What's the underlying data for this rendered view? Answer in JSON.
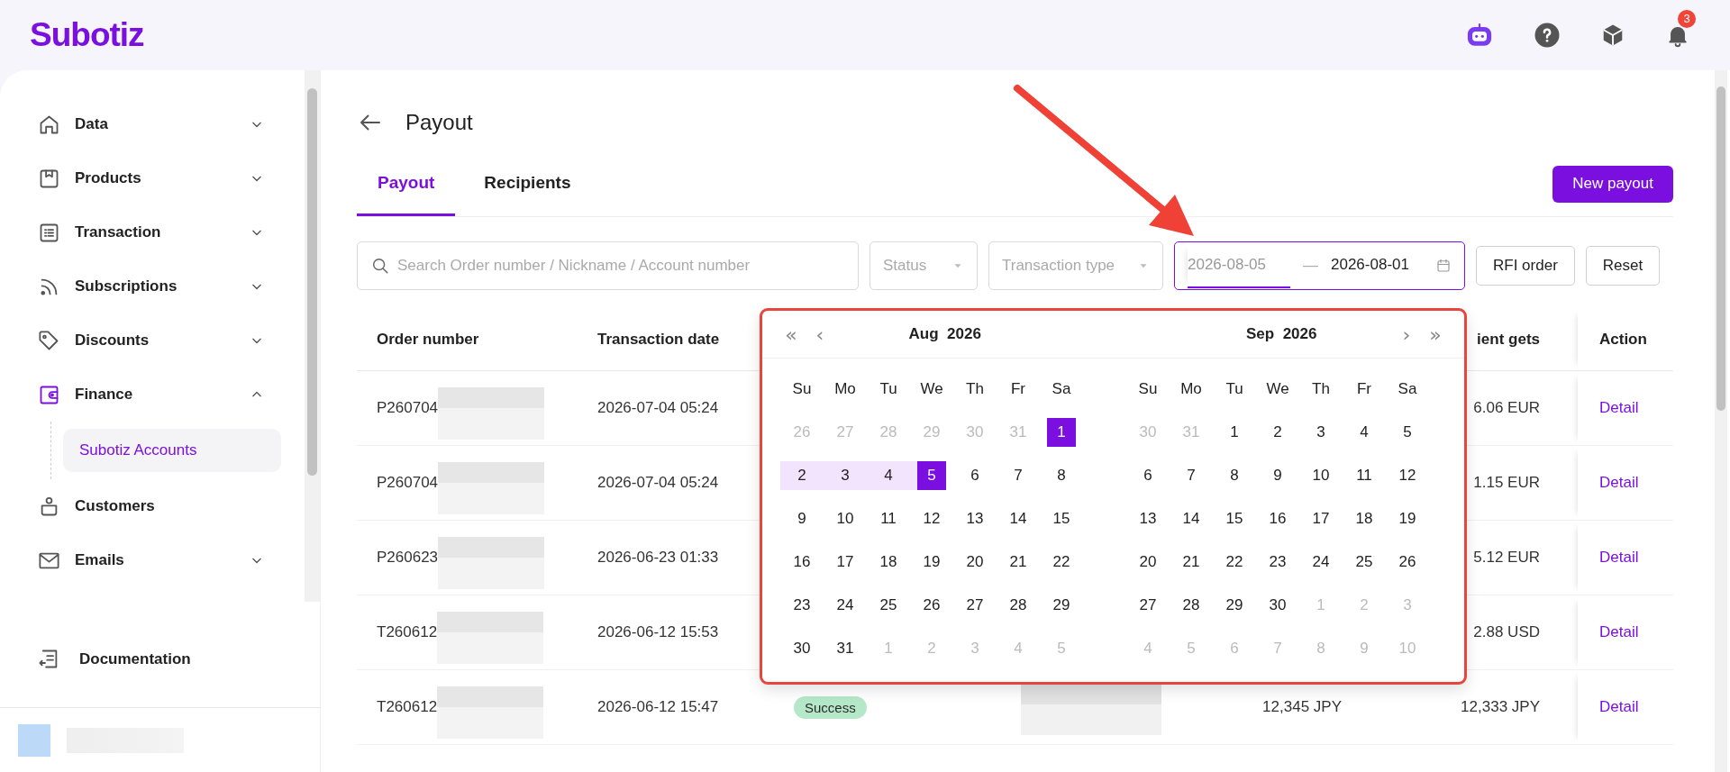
{
  "header": {
    "logo": "Subotiz",
    "notification_count": "3"
  },
  "sidebar": {
    "items": [
      {
        "label": "Data",
        "kind": "group",
        "expanded": false
      },
      {
        "label": "Products",
        "kind": "group",
        "expanded": false
      },
      {
        "label": "Transaction",
        "kind": "group",
        "expanded": false
      },
      {
        "label": "Subscriptions",
        "kind": "group",
        "expanded": false
      },
      {
        "label": "Discounts",
        "kind": "group",
        "expanded": false
      },
      {
        "label": "Finance",
        "kind": "group",
        "expanded": true,
        "children": [
          {
            "label": "Subotiz Accounts",
            "selected": true
          }
        ]
      },
      {
        "label": "Customers",
        "kind": "link"
      },
      {
        "label": "Emails",
        "kind": "group",
        "expanded": false
      }
    ],
    "footer": {
      "label": "Documentation"
    }
  },
  "page": {
    "title": "Payout",
    "tabs": [
      {
        "label": "Payout",
        "selected": true
      },
      {
        "label": "Recipients",
        "selected": false
      }
    ],
    "primary_button": "New payout"
  },
  "filters": {
    "search": {
      "placeholder": "Search Order number / Nickname / Account number"
    },
    "status": {
      "placeholder": "Status"
    },
    "transaction_type": {
      "placeholder": "Transaction type"
    },
    "date_range": {
      "start": {
        "value": "2026-08-05",
        "active": true
      },
      "separator": "—",
      "end": {
        "value": "2026-08-01",
        "active": false
      }
    },
    "buttons": [
      "RFI order",
      "Reset"
    ]
  },
  "table": {
    "columns": [
      "Order number",
      "Transaction date",
      null,
      null,
      null,
      "ient gets",
      "Action"
    ],
    "rows": [
      {
        "order_number": "P260704",
        "transaction_date": "2026-07-04 05:24",
        "recipient_gets": "6.06 EUR",
        "action": "Detail"
      },
      {
        "order_number": "P260704",
        "transaction_date": "2026-07-04 05:24",
        "recipient_gets": "1.15 EUR",
        "action": "Detail"
      },
      {
        "order_number": "P260623",
        "transaction_date": "2026-06-23 01:33",
        "recipient_gets": "5.12 EUR",
        "action": "Detail"
      },
      {
        "order_number": "T260612",
        "transaction_date": "2026-06-12 15:53",
        "recipient_gets": "2.88 USD",
        "action": "Detail"
      },
      {
        "order_number": "T260612",
        "transaction_date": "2026-06-12 15:47",
        "status": "Success",
        "amount": "12,345 JPY",
        "recipient_gets": "12,333 JPY",
        "action": "Detail"
      }
    ]
  },
  "calendar": {
    "nav": {
      "prev_year": "«",
      "prev_month": "‹",
      "next_month": "›",
      "next_year": "»"
    },
    "months": [
      {
        "title": "Aug  2026",
        "weekdays": [
          "Su",
          "Mo",
          "Tu",
          "We",
          "Th",
          "Fr",
          "Sa"
        ],
        "weeks": [
          [
            {
              "day": "26",
              "outside": true,
              "selected": false,
              "in_range": false
            },
            {
              "day": "27",
              "outside": true,
              "selected": false,
              "in_range": false
            },
            {
              "day": "28",
              "outside": true,
              "selected": false,
              "in_range": false
            },
            {
              "day": "29",
              "outside": true,
              "selected": false,
              "in_range": false
            },
            {
              "day": "30",
              "outside": true,
              "selected": false,
              "in_range": false
            },
            {
              "day": "31",
              "outside": true,
              "selected": false,
              "in_range": false
            },
            {
              "day": "1",
              "outside": false,
              "selected": true,
              "in_range": false
            }
          ],
          [
            {
              "day": "2",
              "outside": false,
              "selected": false,
              "in_range": true
            },
            {
              "day": "3",
              "outside": false,
              "selected": false,
              "in_range": true
            },
            {
              "day": "4",
              "outside": false,
              "selected": false,
              "in_range": true
            },
            {
              "day": "5",
              "outside": false,
              "selected": true,
              "in_range": false
            },
            {
              "day": "6",
              "outside": false,
              "selected": false,
              "in_range": false
            },
            {
              "day": "7",
              "outside": false,
              "selected": false,
              "in_range": false
            },
            {
              "day": "8",
              "outside": false,
              "selected": false,
              "in_range": false
            }
          ],
          [
            {
              "day": "9",
              "outside": false,
              "selected": false,
              "in_range": false
            },
            {
              "day": "10",
              "outside": false,
              "selected": false,
              "in_range": false
            },
            {
              "day": "11",
              "outside": false,
              "selected": false,
              "in_range": false
            },
            {
              "day": "12",
              "outside": false,
              "selected": false,
              "in_range": false
            },
            {
              "day": "13",
              "outside": false,
              "selected": false,
              "in_range": false
            },
            {
              "day": "14",
              "outside": false,
              "selected": false,
              "in_range": false
            },
            {
              "day": "15",
              "outside": false,
              "selected": false,
              "in_range": false
            }
          ],
          [
            {
              "day": "16",
              "outside": false,
              "selected": false,
              "in_range": false
            },
            {
              "day": "17",
              "outside": false,
              "selected": false,
              "in_range": false
            },
            {
              "day": "18",
              "outside": false,
              "selected": false,
              "in_range": false
            },
            {
              "day": "19",
              "outside": false,
              "selected": false,
              "in_range": false
            },
            {
              "day": "20",
              "outside": false,
              "selected": false,
              "in_range": false
            },
            {
              "day": "21",
              "outside": false,
              "selected": false,
              "in_range": false
            },
            {
              "day": "22",
              "outside": false,
              "selected": false,
              "in_range": false
            }
          ],
          [
            {
              "day": "23",
              "outside": false,
              "selected": false,
              "in_range": false
            },
            {
              "day": "24",
              "outside": false,
              "selected": false,
              "in_range": false
            },
            {
              "day": "25",
              "outside": false,
              "selected": false,
              "in_range": false
            },
            {
              "day": "26",
              "outside": false,
              "selected": false,
              "in_range": false
            },
            {
              "day": "27",
              "outside": false,
              "selected": false,
              "in_range": false
            },
            {
              "day": "28",
              "outside": false,
              "selected": false,
              "in_range": false
            },
            {
              "day": "29",
              "outside": false,
              "selected": false,
              "in_range": false
            }
          ],
          [
            {
              "day": "30",
              "outside": false,
              "selected": false,
              "in_range": false
            },
            {
              "day": "31",
              "outside": false,
              "selected": false,
              "in_range": false
            },
            {
              "day": "1",
              "outside": true,
              "selected": false,
              "in_range": false
            },
            {
              "day": "2",
              "outside": true,
              "selected": false,
              "in_range": false
            },
            {
              "day": "3",
              "outside": true,
              "selected": false,
              "in_range": false
            },
            {
              "day": "4",
              "outside": true,
              "selected": false,
              "in_range": false
            },
            {
              "day": "5",
              "outside": true,
              "selected": false,
              "in_range": false
            }
          ]
        ]
      },
      {
        "title": "Sep  2026",
        "weekdays": [
          "Su",
          "Mo",
          "Tu",
          "We",
          "Th",
          "Fr",
          "Sa"
        ],
        "weeks": [
          [
            {
              "day": "30",
              "outside": true,
              "selected": false,
              "in_range": false
            },
            {
              "day": "31",
              "outside": true,
              "selected": false,
              "in_range": false
            },
            {
              "day": "1",
              "outside": false,
              "selected": false,
              "in_range": false
            },
            {
              "day": "2",
              "outside": false,
              "selected": false,
              "in_range": false
            },
            {
              "day": "3",
              "outside": false,
              "selected": false,
              "in_range": false
            },
            {
              "day": "4",
              "outside": false,
              "selected": false,
              "in_range": false
            },
            {
              "day": "5",
              "outside": false,
              "selected": false,
              "in_range": false
            }
          ],
          [
            {
              "day": "6",
              "outside": false,
              "selected": false,
              "in_range": false
            },
            {
              "day": "7",
              "outside": false,
              "selected": false,
              "in_range": false
            },
            {
              "day": "8",
              "outside": false,
              "selected": false,
              "in_range": false
            },
            {
              "day": "9",
              "outside": false,
              "selected": false,
              "in_range": false
            },
            {
              "day": "10",
              "outside": false,
              "selected": false,
              "in_range": false
            },
            {
              "day": "11",
              "outside": false,
              "selected": false,
              "in_range": false
            },
            {
              "day": "12",
              "outside": false,
              "selected": false,
              "in_range": false
            }
          ],
          [
            {
              "day": "13",
              "outside": false,
              "selected": false,
              "in_range": false
            },
            {
              "day": "14",
              "outside": false,
              "selected": false,
              "in_range": false
            },
            {
              "day": "15",
              "outside": false,
              "selected": false,
              "in_range": false
            },
            {
              "day": "16",
              "outside": false,
              "selected": false,
              "in_range": false
            },
            {
              "day": "17",
              "outside": false,
              "selected": false,
              "in_range": false
            },
            {
              "day": "18",
              "outside": false,
              "selected": false,
              "in_range": false
            },
            {
              "day": "19",
              "outside": false,
              "selected": false,
              "in_range": false
            }
          ],
          [
            {
              "day": "20",
              "outside": false,
              "selected": false,
              "in_range": false
            },
            {
              "day": "21",
              "outside": false,
              "selected": false,
              "in_range": false
            },
            {
              "day": "22",
              "outside": false,
              "selected": false,
              "in_range": false
            },
            {
              "day": "23",
              "outside": false,
              "selected": false,
              "in_range": false
            },
            {
              "day": "24",
              "outside": false,
              "selected": false,
              "in_range": false
            },
            {
              "day": "25",
              "outside": false,
              "selected": false,
              "in_range": false
            },
            {
              "day": "26",
              "outside": false,
              "selected": false,
              "in_range": false
            }
          ],
          [
            {
              "day": "27",
              "outside": false,
              "selected": false,
              "in_range": false
            },
            {
              "day": "28",
              "outside": false,
              "selected": false,
              "in_range": false
            },
            {
              "day": "29",
              "outside": false,
              "selected": false,
              "in_range": false
            },
            {
              "day": "30",
              "outside": false,
              "selected": false,
              "in_range": false
            },
            {
              "day": "1",
              "outside": true,
              "selected": false,
              "in_range": false
            },
            {
              "day": "2",
              "outside": true,
              "selected": false,
              "in_range": false
            },
            {
              "day": "3",
              "outside": true,
              "selected": false,
              "in_range": false
            }
          ],
          [
            {
              "day": "4",
              "outside": true,
              "selected": false,
              "in_range": false
            },
            {
              "day": "5",
              "outside": true,
              "selected": false,
              "in_range": false
            },
            {
              "day": "6",
              "outside": true,
              "selected": false,
              "in_range": false
            },
            {
              "day": "7",
              "outside": true,
              "selected": false,
              "in_range": false
            },
            {
              "day": "8",
              "outside": true,
              "selected": false,
              "in_range": false
            },
            {
              "day": "9",
              "outside": true,
              "selected": false,
              "in_range": false
            },
            {
              "day": "10",
              "outside": true,
              "selected": false,
              "in_range": false
            }
          ]
        ]
      }
    ]
  }
}
